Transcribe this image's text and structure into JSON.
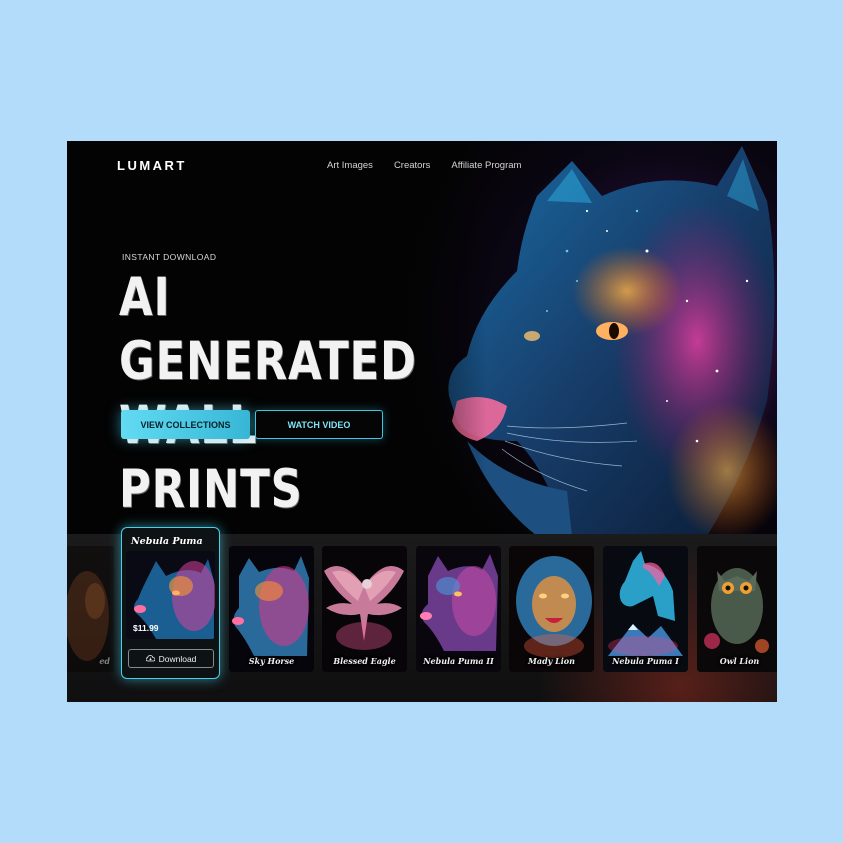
{
  "brand": {
    "logo": "LUMART"
  },
  "nav": {
    "items": [
      "Art Images",
      "Creators",
      "Affiliate Program"
    ]
  },
  "hero": {
    "eyebrow": "INSTANT DOWNLOAD",
    "headline_line1": "AI GENERATED",
    "headline_line2": "WALL PRINTS",
    "primary_button": "VIEW COLLECTIONS",
    "secondary_button": "WATCH VIDEO"
  },
  "featured": {
    "title": "Nebula Puma",
    "price": "$11.99",
    "download_label": "Download",
    "icon": "cloud-download-icon"
  },
  "gallery": {
    "partial_left_title": "ed",
    "items": [
      {
        "title": "Sky Horse",
        "subject": "puma"
      },
      {
        "title": "Blessed Eagle",
        "subject": "eagle"
      },
      {
        "title": "Nebula Puma II",
        "subject": "puma"
      },
      {
        "title": "Mady Lion",
        "subject": "lion"
      },
      {
        "title": "Nebula Puma I",
        "subject": "horse"
      },
      {
        "title": "Owl Lion",
        "subject": "owl"
      }
    ]
  },
  "colors": {
    "accent": "#49cfe9",
    "page_bg": "#b3dcfb",
    "screen_bg": "#030303"
  }
}
